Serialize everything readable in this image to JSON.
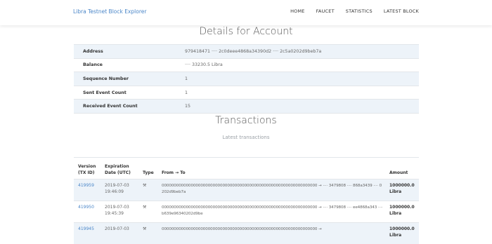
{
  "nav": {
    "brand": "Libra Testnet Block Explorer",
    "links": [
      "HOME",
      "FAUCET",
      "STATISTICS",
      "LATEST BLOCK"
    ]
  },
  "account": {
    "title": "Details for Account",
    "rows": [
      {
        "label": "Address",
        "value": "979418471 ···· 2c0deee4868a34390d2 ···· 2c5a0202d9beb7a"
      },
      {
        "label": "Balance",
        "value": "···· 33230.5 Libra"
      },
      {
        "label": "Sequence Number",
        "value": "1"
      },
      {
        "label": "Sent Event Count",
        "value": "1"
      },
      {
        "label": "Received Event Count",
        "value": "15"
      }
    ]
  },
  "transactions": {
    "title": "Transactions",
    "subtitle": "Latest transactions",
    "headers": {
      "version": "Version (TX ID)",
      "date": "Expiration Date (UTC)",
      "type": "Type",
      "fromto": "From → To",
      "amount": "Amount"
    },
    "rows": [
      {
        "version": "419959",
        "date": "2019-07-03 19:46:09",
        "type_icon": "⚒",
        "fromto": "0000000000000000000000000000000000000000000000000000000000000000 → ···· 3479808 ···· 868a3439 ···· 0202d9beb7a",
        "amount": "1000000.0 Libra"
      },
      {
        "version": "419950",
        "date": "2019-07-03 19:45:39",
        "type_icon": "⚒",
        "fromto": "0000000000000000000000000000000000000000000000000000000000000000 → ···· 3479808 ···· ee4868a343 ···· b639e96340202d9be",
        "amount": "1000000.0 Libra"
      },
      {
        "version": "419945",
        "date": "2019-07-03",
        "type_icon": "⚒",
        "fromto": "0000000000000000000000000000000000000000000000000000000000000000 →",
        "amount": "1000000.0 Libra"
      }
    ]
  }
}
